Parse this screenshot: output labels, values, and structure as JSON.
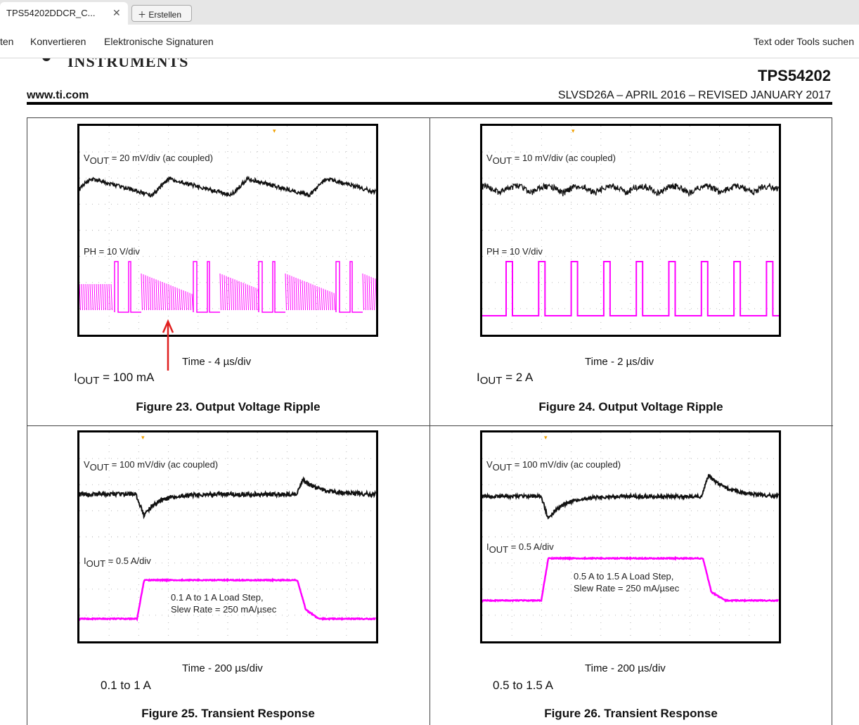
{
  "browser": {
    "tab_title": "TPS54202DDCR_C...",
    "new_button": "Erstellen"
  },
  "toolbar": {
    "items": [
      "ten",
      "Konvertieren",
      "Elektronische Signaturen"
    ],
    "search": "Text oder Tools suchen"
  },
  "header": {
    "logo": "INSTRUMENTS",
    "part": "TPS54202",
    "site": "www.ti.com",
    "doc": "SLVSD26A – APRIL 2016 – REVISED JANUARY 2017"
  },
  "figures": [
    {
      "top_sym": "V",
      "top_sub": "OUT",
      "top_rest": " = 20 mV/div (ac coupled)",
      "bot_sym": "PH = 10 V/div",
      "bot_sub": "",
      "bot_rest": "",
      "time": "Time - 4 µs/div",
      "iout_sym": "I",
      "iout_sub": "OUT",
      "iout_rest": " = 100 mA",
      "caption": "Figure 23. Output Voltage Ripple"
    },
    {
      "top_sym": "V",
      "top_sub": "OUT",
      "top_rest": " = 10 mV/div (ac coupled)",
      "bot_sym": "PH = 10 V/div",
      "bot_sub": "",
      "bot_rest": "",
      "time": "Time - 2 µs/div",
      "iout_sym": "I",
      "iout_sub": "OUT",
      "iout_rest": " = 2 A",
      "caption": "Figure 24. Output Voltage Ripple"
    },
    {
      "top_sym": "V",
      "top_sub": "OUT",
      "top_rest": " = 100 mV/div (ac coupled)",
      "bot_sym": "I",
      "bot_sub": "OUT",
      "bot_rest": " = 0.5 A/div",
      "note1": "0.1 A to 1 A Load Step,",
      "note2": "Slew Rate = 250 mA/µsec",
      "time": "Time - 200 µs/div",
      "iout_text": "0.1 to 1 A",
      "caption": "Figure 25. Transient Response"
    },
    {
      "top_sym": "V",
      "top_sub": "OUT",
      "top_rest": " = 100 mV/div (ac coupled)",
      "bot_sym": "I",
      "bot_sub": "OUT",
      "bot_rest": " = 0.5 A/div",
      "note1": "0.5 A to 1.5 A Load Step,",
      "note2": "Slew Rate = 250 mA/µsec",
      "time": "Time - 200 µs/div",
      "iout_text": "0.5 to 1.5 A",
      "caption": "Figure 26. Transient Response"
    }
  ],
  "colors": {
    "trace_top": "#111111",
    "trace_bottom": "#ff00ff",
    "annotation": "#e02020",
    "trigger": "#f0a000"
  }
}
